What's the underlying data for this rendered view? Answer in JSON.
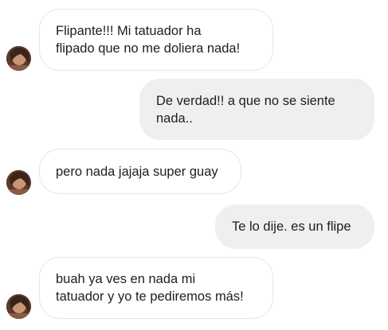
{
  "messages": [
    {
      "sender": "them",
      "text": "Flipante!!! Mi tatuador ha\nflipado que no me doliera nada!"
    },
    {
      "sender": "me",
      "text": "De verdad!! a que no se siente\nnada.."
    },
    {
      "sender": "them",
      "text": "pero nada jajaja super guay"
    },
    {
      "sender": "me",
      "text": "Te lo dije. es un flipe"
    },
    {
      "sender": "them",
      "text": "buah ya ves en nada mi\ntatuador y yo te pediremos más!"
    }
  ],
  "colors": {
    "incoming_bg": "#ffffff",
    "incoming_border": "#e4e6eb",
    "outgoing_bg": "#efefef",
    "text": "#1c1e21"
  },
  "icons": {
    "avatar": "contact-avatar-photo"
  }
}
